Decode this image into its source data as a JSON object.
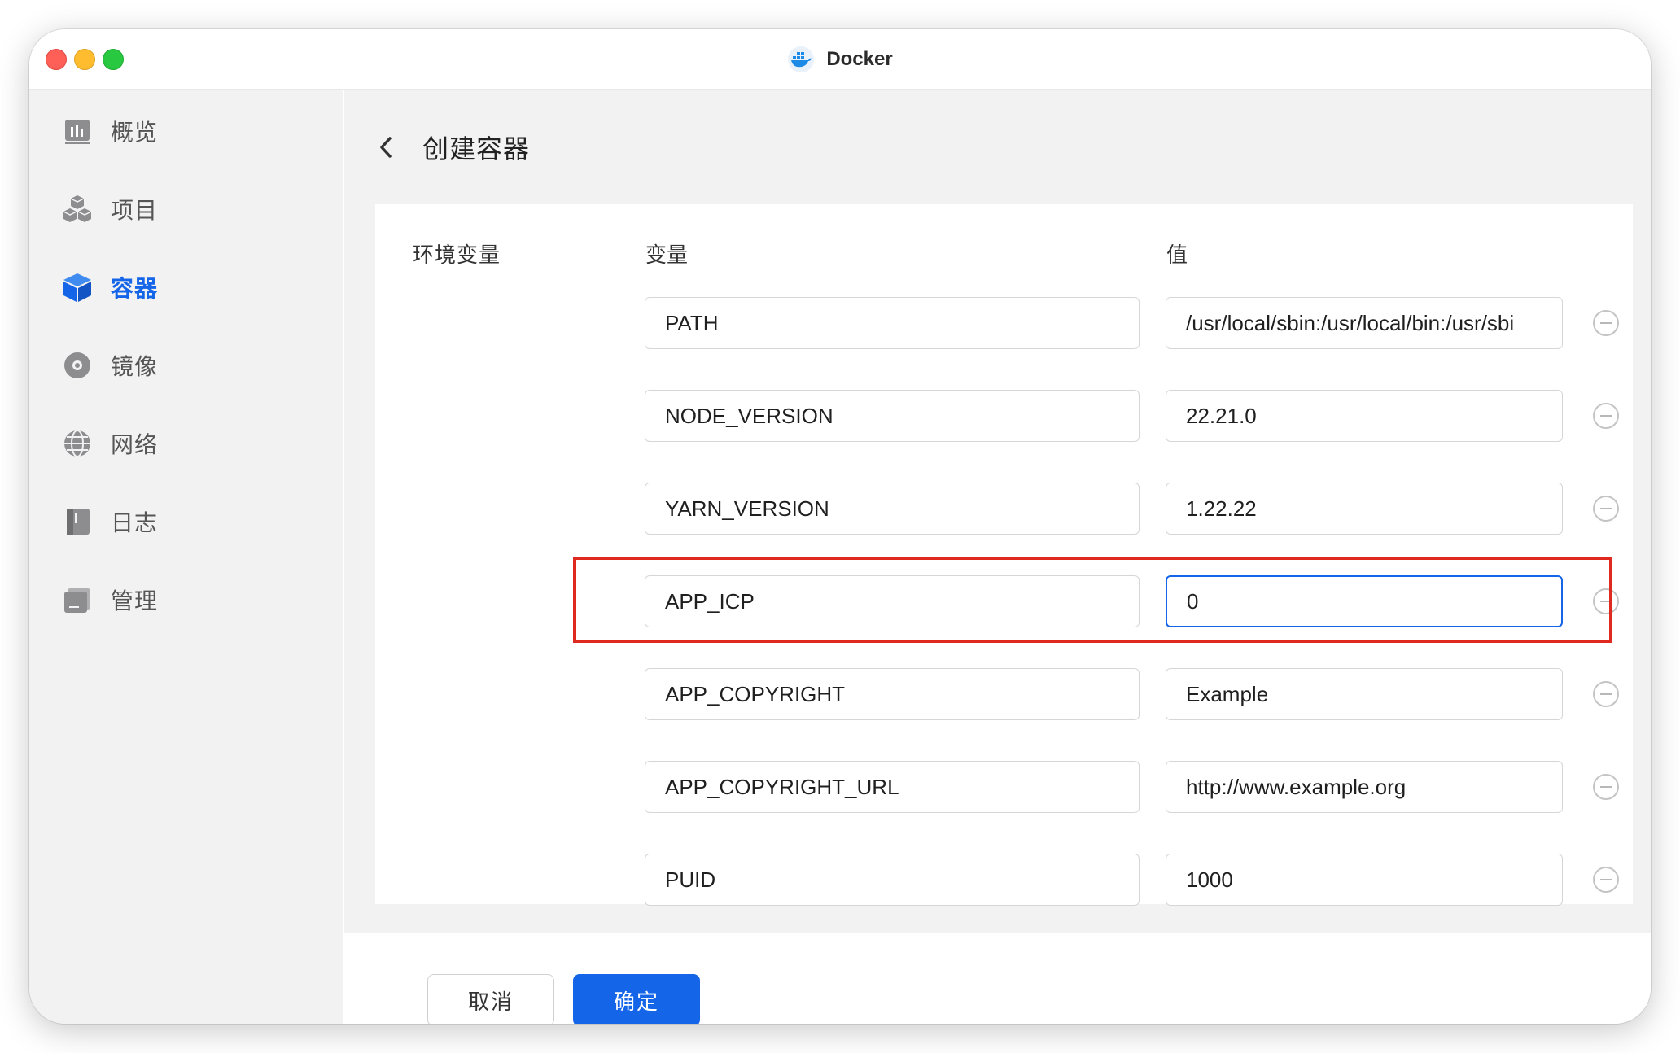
{
  "window": {
    "title": "Docker"
  },
  "sidebar": {
    "items": [
      {
        "label": "概览",
        "icon": "dashboard-icon",
        "active": false
      },
      {
        "label": "项目",
        "icon": "project-cubes-icon",
        "active": false
      },
      {
        "label": "容器",
        "icon": "container-box-icon",
        "active": true
      },
      {
        "label": "镜像",
        "icon": "image-disc-icon",
        "active": false
      },
      {
        "label": "网络",
        "icon": "network-globe-icon",
        "active": false
      },
      {
        "label": "日志",
        "icon": "log-book-icon",
        "active": false
      },
      {
        "label": "管理",
        "icon": "manage-icon",
        "active": false
      }
    ]
  },
  "page": {
    "title": "创建容器",
    "section_label": "环境变量",
    "col_variable": "变量",
    "col_value": "值"
  },
  "env": [
    {
      "key": "PATH",
      "value": "/usr/local/sbin:/usr/local/bin:/usr/sbi"
    },
    {
      "key": "NODE_VERSION",
      "value": "22.21.0"
    },
    {
      "key": "YARN_VERSION",
      "value": "1.22.22"
    },
    {
      "key": "APP_ICP",
      "value": "0",
      "focused": true
    },
    {
      "key": "APP_COPYRIGHT",
      "value": "Example"
    },
    {
      "key": "APP_COPYRIGHT_URL",
      "value": "http://www.example.org"
    },
    {
      "key": "PUID",
      "value": "1000"
    }
  ],
  "footer": {
    "cancel_label": "取消",
    "confirm_label": "确定"
  },
  "colors": {
    "accent": "#1565e8",
    "highlight": "#e02a1f"
  }
}
